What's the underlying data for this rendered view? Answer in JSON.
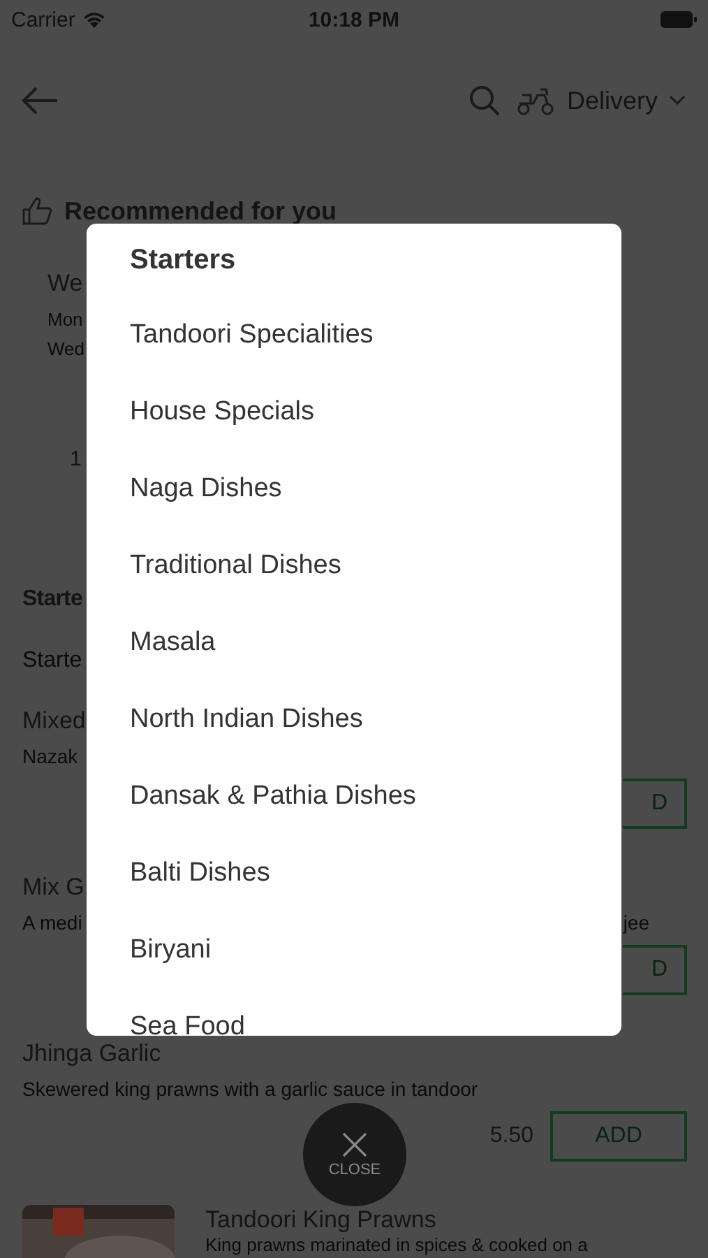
{
  "status_bar": {
    "carrier": "Carrier",
    "time": "10:18 PM"
  },
  "header": {
    "order_mode": "Delivery"
  },
  "recommended": {
    "title": "Recommended for you",
    "texts": [
      {
        "kind": "title",
        "text": "We"
      },
      {
        "kind": "subtitle",
        "text": "Mon"
      },
      {
        "kind": "subtitle",
        "text": "Wed"
      },
      {
        "kind": "count",
        "text": "1"
      }
    ]
  },
  "menu": {
    "section_title": "Starte",
    "subsection_title": "Starte",
    "items": [
      {
        "name": "Mixed",
        "description": "Nazak",
        "add_label": "D",
        "partial": true
      },
      {
        "name": "Mix G",
        "description": "A medi",
        "description_end": "jee",
        "add_label": "D",
        "partial": true
      },
      {
        "name": "Jhinga Garlic",
        "description": "Skewered king prawns with a garlic sauce in tandoor",
        "price": "5.50",
        "add_label": "ADD",
        "partial": false
      },
      {
        "name": "Tandoori King Prawns",
        "description": "King prawns marinated in spices & cooked on a",
        "kind": "picture"
      }
    ]
  },
  "category_modal": {
    "title": "Starters",
    "categories": [
      "Tandoori Specialities",
      "House Specials",
      "Naga Dishes",
      "Traditional Dishes",
      "Masala",
      "North Indian Dishes",
      "Dansak & Pathia Dishes",
      "Balti Dishes",
      "Biryani",
      "Sea Food"
    ]
  },
  "close_button": {
    "label": "CLOSE"
  }
}
